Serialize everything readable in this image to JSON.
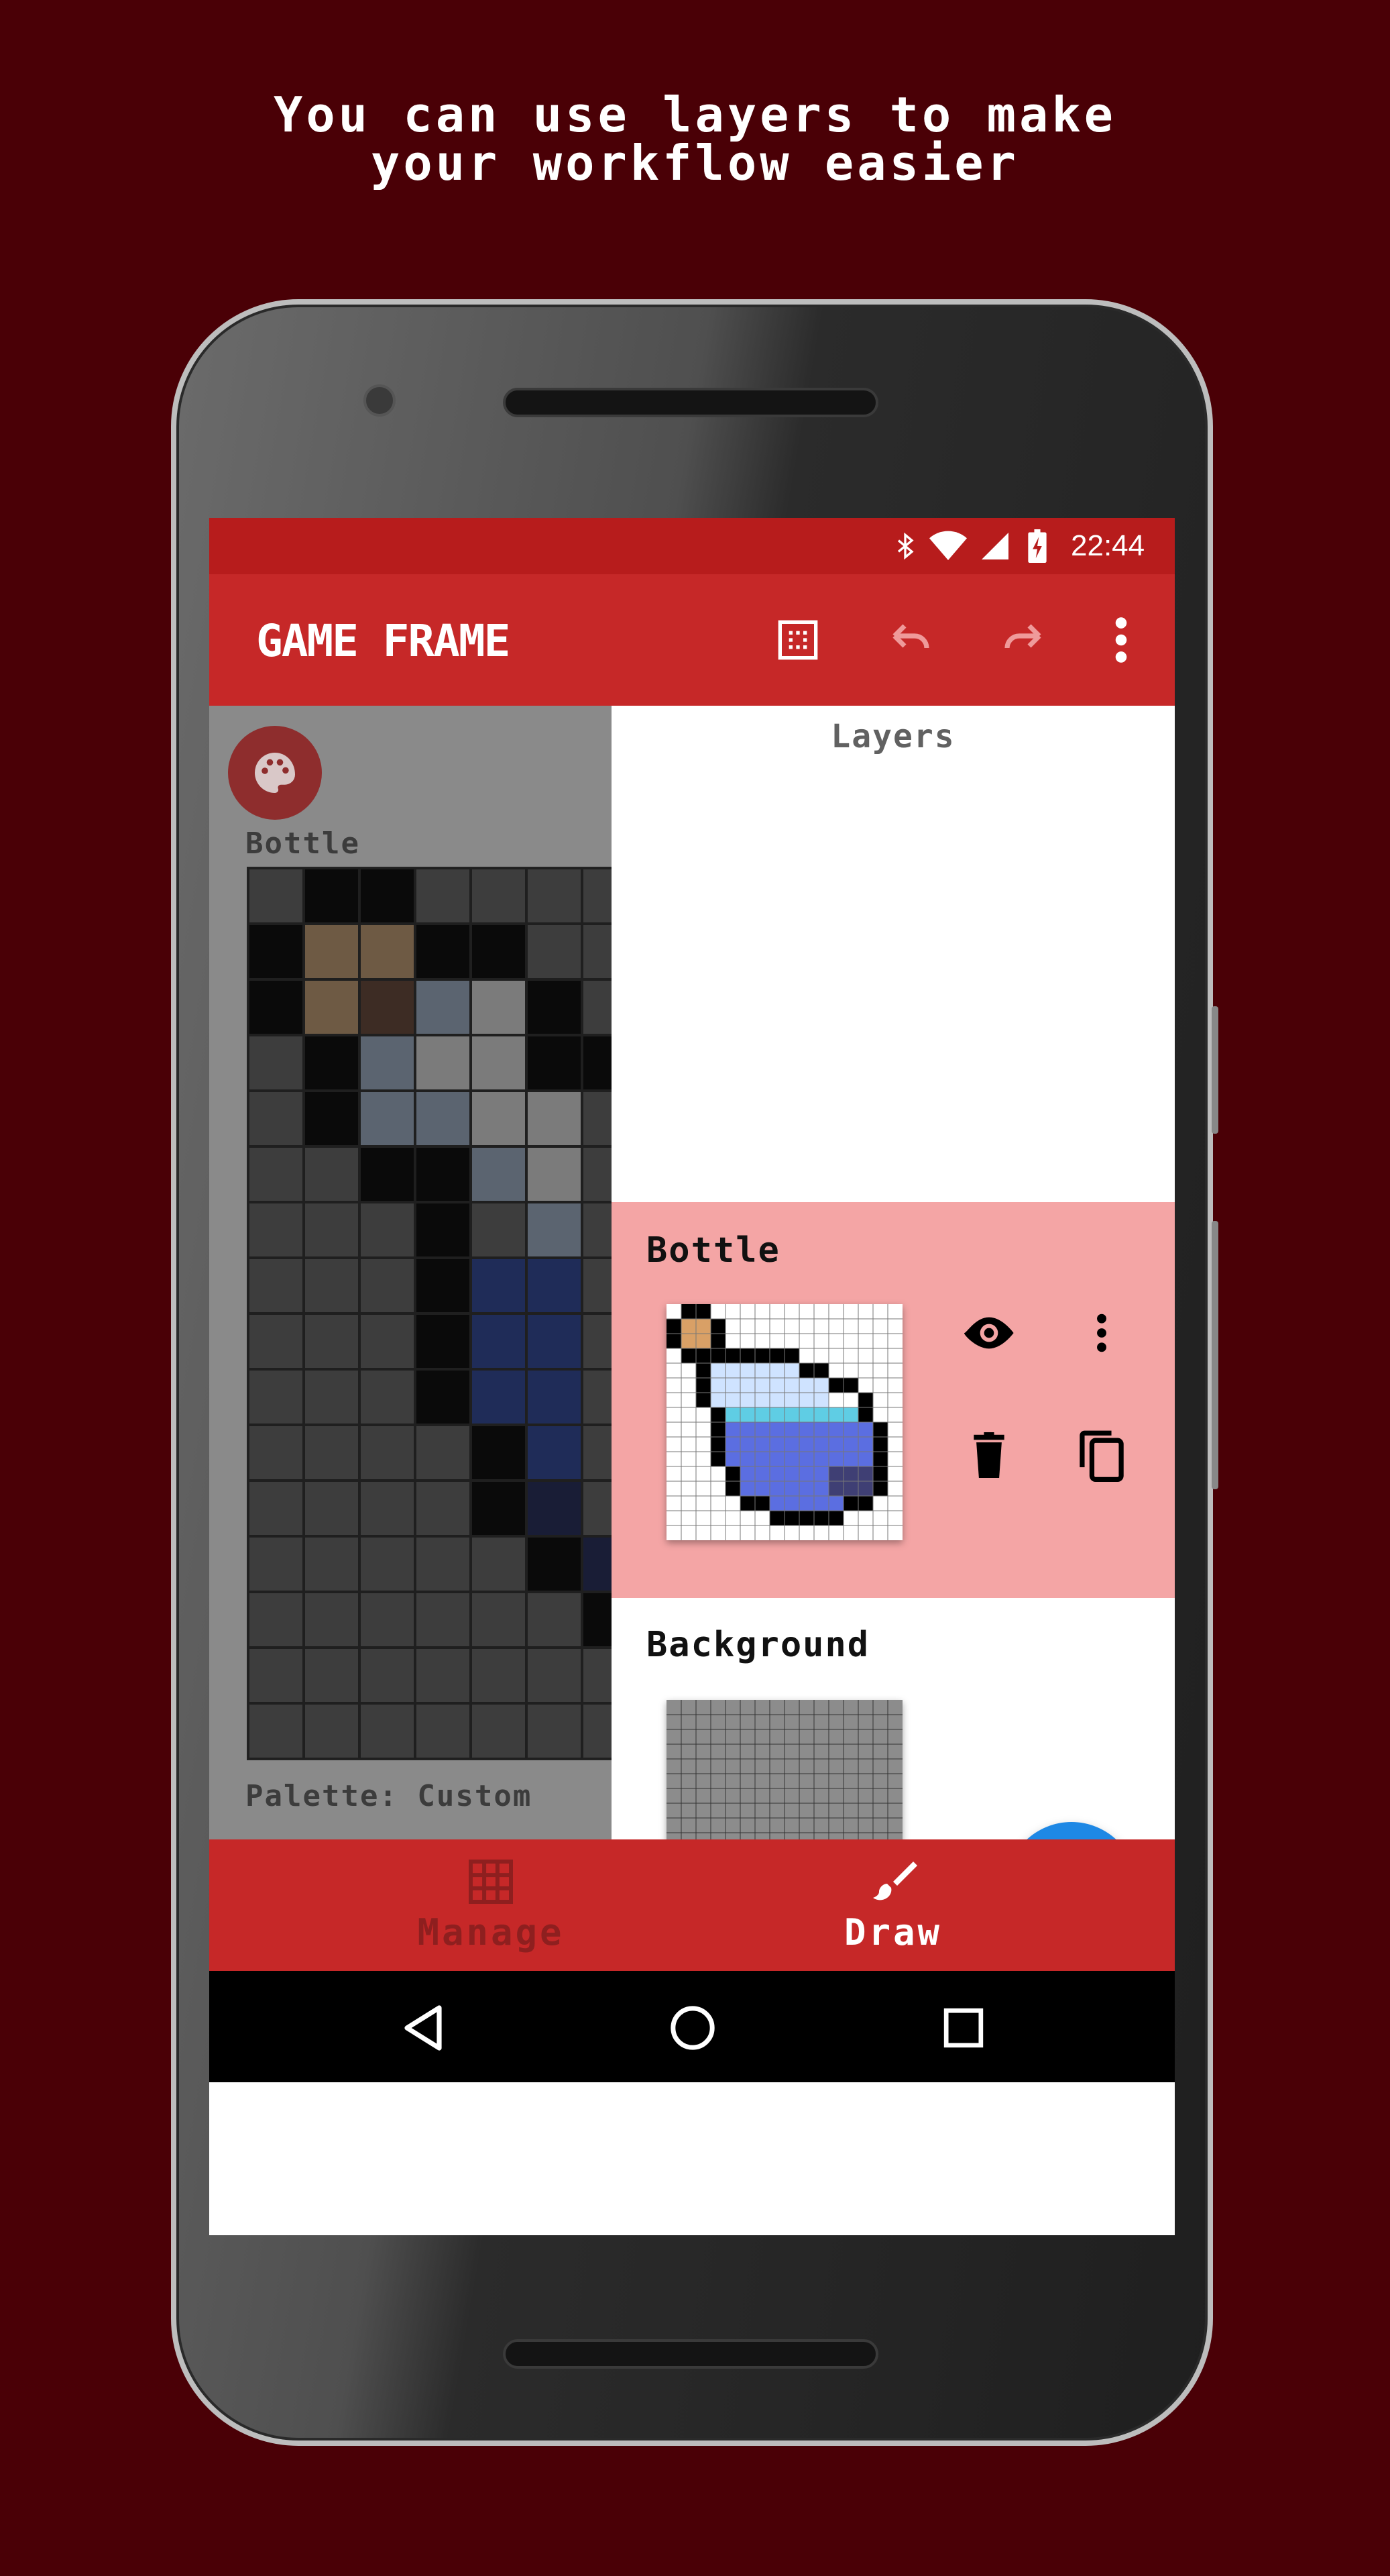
{
  "headline": {
    "line1": "You can use layers to make",
    "line2": "your workflow easier"
  },
  "statusbar": {
    "time": "22:44",
    "icons": [
      "bluetooth-icon",
      "wifi-icon",
      "cell-signal-icon",
      "battery-charging-icon"
    ]
  },
  "appbar": {
    "logo_text": "GAME FRAME",
    "actions": [
      "grid-icon",
      "undo-icon",
      "redo-icon",
      "more-vert-icon"
    ]
  },
  "canvas": {
    "palette_button_icon": "palette-icon",
    "layer_label": "Bottle",
    "palette_label": "Palette: Custom",
    "palette_colors": [
      "#1c1e3a",
      "#2b3a8f",
      "#3b5cbf",
      "#7a6650",
      "#3a2a22",
      "#4a5554"
    ],
    "selected_swatch_color": "#111111"
  },
  "layers": {
    "title": "Layers",
    "items": [
      {
        "name": "Bottle",
        "selected": true,
        "actions": [
          "eye-icon",
          "more-vert-icon",
          "delete-icon",
          "copy-icon"
        ]
      },
      {
        "name": "Background",
        "selected": false
      }
    ],
    "add_button": "+"
  },
  "bottomnav": {
    "items": [
      {
        "label": "Manage",
        "icon": "grid-icon",
        "active": false
      },
      {
        "label": "Draw",
        "icon": "brush-icon",
        "active": true
      }
    ]
  },
  "systemnav": [
    "back-icon",
    "home-icon",
    "recents-icon"
  ],
  "colors": {
    "background": "#4a0006",
    "primary": "#c62828",
    "primary_dark": "#b71c1c",
    "selected_layer": "#f4a5a5",
    "fab": "#1e88e5"
  }
}
